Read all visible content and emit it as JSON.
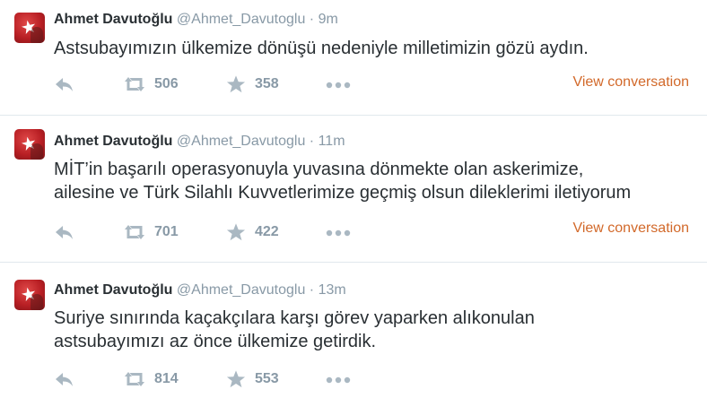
{
  "tweets": [
    {
      "name": "Ahmet Davutoğlu",
      "handle": "@Ahmet_Davutoglu",
      "separator": "·",
      "time": "9m",
      "text_lines": [
        "Astsubayımızın ülkemize dönüşü nedeniyle milletimizin gözü aydın."
      ],
      "retweets": "506",
      "favorites": "358",
      "view_conversation": "View conversation"
    },
    {
      "name": "Ahmet Davutoğlu",
      "handle": "@Ahmet_Davutoglu",
      "separator": "·",
      "time": "11m",
      "text_lines": [
        "MİT’in başarılı operasyonuyla yuvasına dönmekte olan askerimize,",
        "ailesine ve Türk Silahlı Kuvvetlerimize geçmiş olsun dileklerimi iletiyorum"
      ],
      "retweets": "701",
      "favorites": "422",
      "view_conversation": "View conversation"
    },
    {
      "name": "Ahmet Davutoğlu",
      "handle": "@Ahmet_Davutoglu",
      "separator": "·",
      "time": "13m",
      "text_lines": [
        "Suriye sınırında kaçakçılara karşı görev yaparken alıkonulan",
        "astsubayımızı az önce ülkemize getirdik."
      ],
      "retweets": "814",
      "favorites": "553"
    }
  ],
  "icons": {
    "reply": "reply-icon",
    "retweet": "retweet-icon",
    "favorite": "star-icon",
    "more": "more-icon"
  },
  "colors": {
    "link": "#d2692a",
    "muted": "#8899a6",
    "text": "#292f33",
    "divider": "#e1e8ed",
    "avatar": "#b81f24"
  }
}
